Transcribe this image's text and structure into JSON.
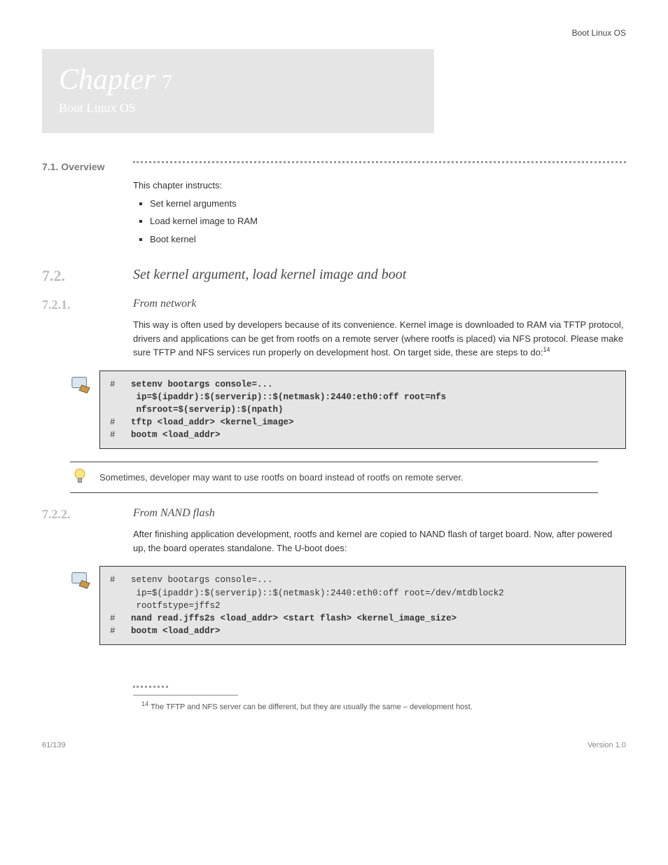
{
  "header_note": "Boot Linux OS",
  "chapter": {
    "label": "Chapter",
    "num": "7",
    "subtitle": "Boot Linux OS"
  },
  "overview": {
    "label": "7.1. Overview",
    "intro": "This chapter instructs:",
    "bullets": [
      "Set kernel arguments",
      "Load kernel image to RAM",
      "Boot kernel"
    ]
  },
  "section72": {
    "num": "7.2.",
    "title": "Set kernel argument, load kernel image and boot"
  },
  "section721": {
    "num": "7.2.1.",
    "title": "From network",
    "intro": "This way is often used by developers because of its convenience. Kernel image is downloaded to RAM via TFTP protocol, drivers and applications can be get from rootfs on a remote server (where rootfs is placed) via NFS protocol. Please make sure TFTP and NFS services run properly on development host. On target side, these are steps to do:"
  },
  "code1": {
    "l1p": "#   ",
    "l1b": "setenv bootargs console=...",
    "l2": "     ip=$(ipaddr):$(serverip)::$(netmask):2440:eth0:off root=nfs",
    "l3": "     nfsroot=$(serverip):$(npath)",
    "l4p": "#   ",
    "l4b": "tftp <load_addr> <kernel_image>",
    "l5p": "#   ",
    "l5b": "bootm <load_addr>"
  },
  "tip": "Sometimes, developer may want to use rootfs on board instead of rootfs on remote server.",
  "section722": {
    "num": "7.2.2.",
    "title": "From NAND flash",
    "intro": "After finishing application development, rootfs and kernel are copied to NAND flash of target board. Now, after powered up, the board operates standalone. The U-boot does:"
  },
  "code2": {
    "l1p": "#   ",
    "l1": "setenv bootargs console=...",
    "l2": "     ip=$(ipaddr):$(serverip)::$(netmask):2440:eth0:off root=/dev/mtdblock2",
    "l3": "     rootfstype=jffs2",
    "l4p": "#   ",
    "l4b": "nand read.jffs2s <load_addr> <start flash> <kernel_image_size>",
    "l5p": "#   ",
    "l5b": "bootm <load_addr>"
  },
  "footnote": {
    "marker": "14",
    "text": " The TFTP and NFS server can be different, but they are usually the same – development host."
  },
  "footer": {
    "left": "61/139",
    "right": "Version 1.0"
  }
}
